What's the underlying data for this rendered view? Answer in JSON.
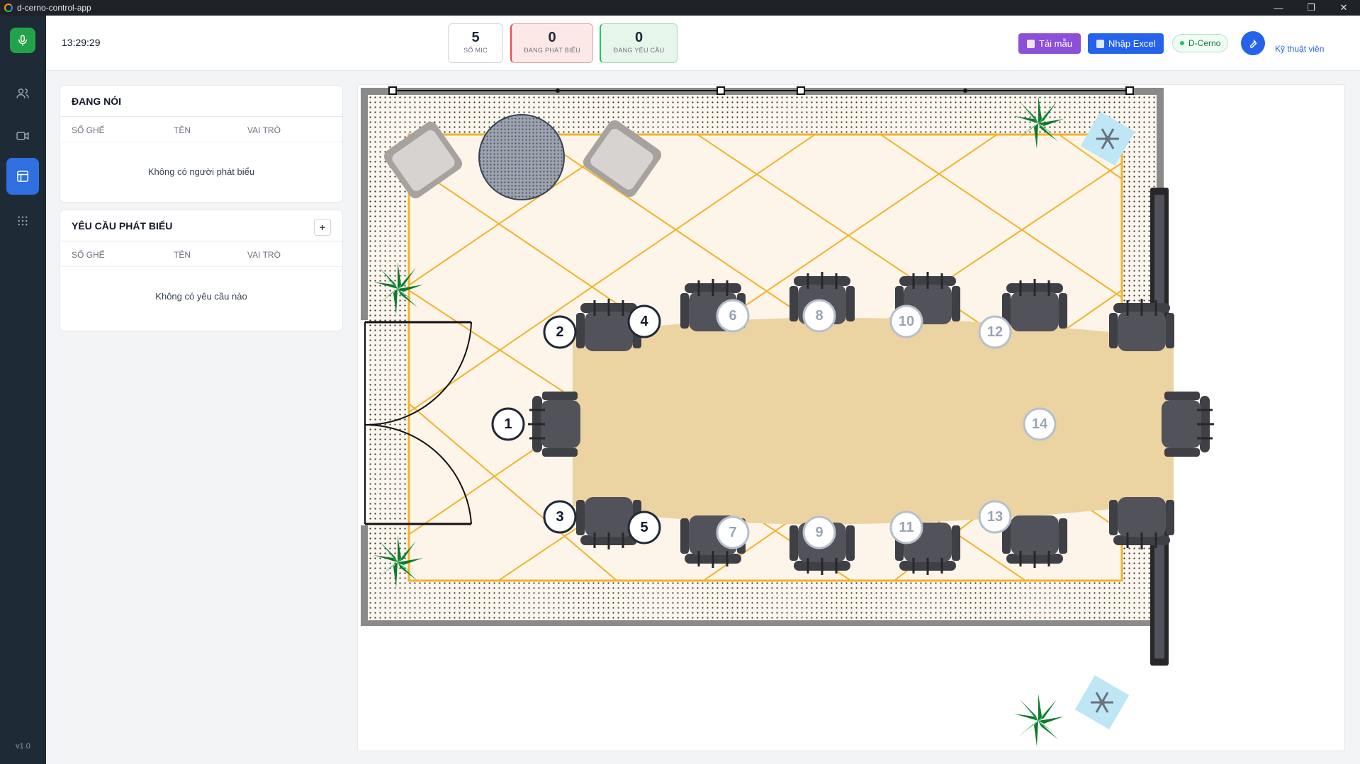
{
  "window": {
    "title": "d-cerno-control-app"
  },
  "sidebar": {
    "version": "v1.0"
  },
  "header": {
    "clock": "13:29:29",
    "stats": [
      {
        "value": "5",
        "label": "SỐ MIC"
      },
      {
        "value": "0",
        "label": "ĐANG PHÁT BIỂU"
      },
      {
        "value": "0",
        "label": "ĐANG YÊU CẦU"
      }
    ],
    "template_button": "Tải mẫu",
    "import_button": "Nhập Excel",
    "device_status": "D-Cerno",
    "user_role": "Kỹ thuật viên"
  },
  "speaking_panel": {
    "title": "ĐANG NÓI",
    "columns": [
      "SỐ GHẾ",
      "TÊN",
      "VAI TRÒ"
    ],
    "empty_text": "Không có người phát biểu"
  },
  "request_panel": {
    "title": "YÊU CẦU PHÁT BIỂU",
    "add_label": "+",
    "columns": [
      "SỐ GHẾ",
      "TÊN",
      "VAI TRÒ"
    ],
    "empty_text": "Không có yêu cầu nào"
  },
  "seats": [
    {
      "number": "1",
      "active": true
    },
    {
      "number": "2",
      "active": true
    },
    {
      "number": "3",
      "active": true
    },
    {
      "number": "4",
      "active": true
    },
    {
      "number": "5",
      "active": true
    },
    {
      "number": "6",
      "active": false
    },
    {
      "number": "7",
      "active": false
    },
    {
      "number": "8",
      "active": false
    },
    {
      "number": "9",
      "active": false
    },
    {
      "number": "10",
      "active": false
    },
    {
      "number": "11",
      "active": false
    },
    {
      "number": "12",
      "active": false
    },
    {
      "number": "13",
      "active": false
    },
    {
      "number": "14",
      "active": false
    }
  ],
  "colors": {
    "active_seat_text": "#111827",
    "inactive_seat_text": "#9aa5b4",
    "table": "#ecd3a2",
    "carpet_line": "#f0b429",
    "sidebar_active": "#2f6fe0"
  }
}
